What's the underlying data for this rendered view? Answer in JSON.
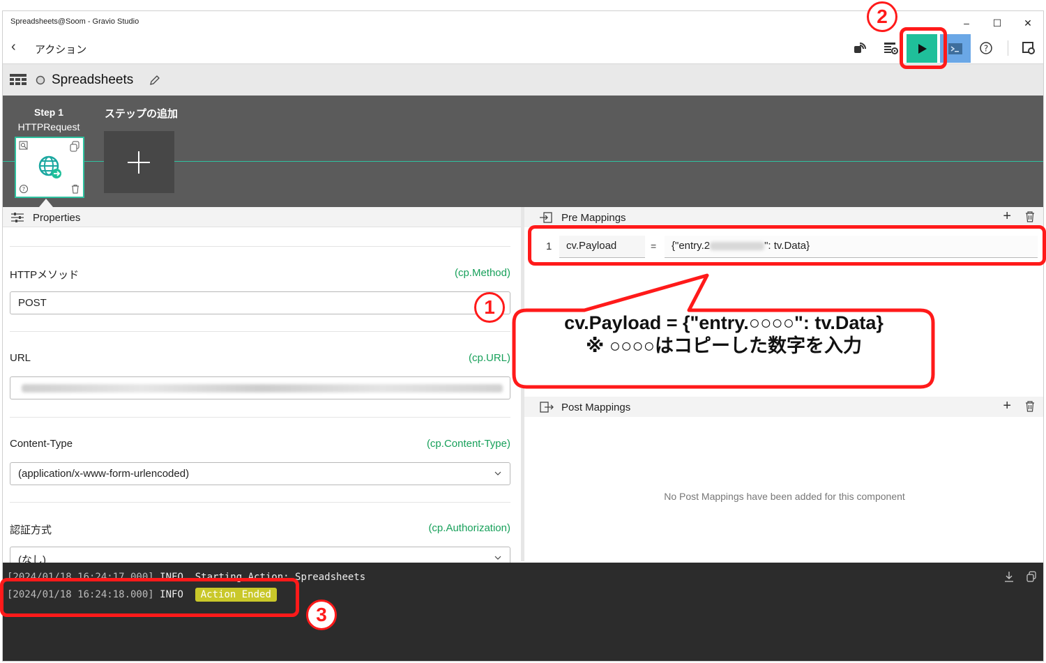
{
  "window": {
    "title": "Spreadsheets@Soom - Gravio Studio",
    "minimize": "–",
    "maximize": "☐",
    "close": "✕"
  },
  "nav": {
    "back": "‹",
    "title": "アクション"
  },
  "action": {
    "name": "Spreadsheets"
  },
  "steps": {
    "step1_title": "Step 1",
    "step1_component": "HTTPRequest",
    "add_label": "ステップの追加"
  },
  "properties": {
    "header": "Properties",
    "fields": [
      {
        "label": "HTTPメソッド",
        "var": "(cp.Method)",
        "value": "POST"
      },
      {
        "label": "URL",
        "var": "(cp.URL)",
        "value": ""
      },
      {
        "label": "Content-Type",
        "var": "(cp.Content-Type)",
        "value": "(application/x-www-form-urlencoded)"
      },
      {
        "label": "認証方式",
        "var": "(cp.Authorization)",
        "value": "(なし)"
      }
    ]
  },
  "pre_mappings": {
    "header": "Pre Mappings",
    "rows": [
      {
        "num": "1",
        "key": "cv.Payload",
        "eq": "=",
        "value_prefix": "{\"entry.2",
        "value_suffix": "\": tv.Data}"
      }
    ]
  },
  "post_mappings": {
    "header": "Post Mappings",
    "empty": "No Post Mappings have been added for this component"
  },
  "console": {
    "lines": [
      {
        "ts": "[2024/01/18 16:24:17.000]",
        "level": "INFO",
        "msg": "Starting Action: Spreadsheets"
      },
      {
        "ts": "[2024/01/18 16:24:18.000]",
        "level": "INFO",
        "msg": "Action Ended"
      }
    ]
  },
  "annotations": {
    "num1": "1",
    "num2": "2",
    "num3": "3",
    "callout_line1": "cv.Payload = {\"entry.○○○○\": tv.Data}",
    "callout_line2": "※ ○○○○はコピーした数字を入力",
    "accent_color": "#ff1a1a"
  }
}
